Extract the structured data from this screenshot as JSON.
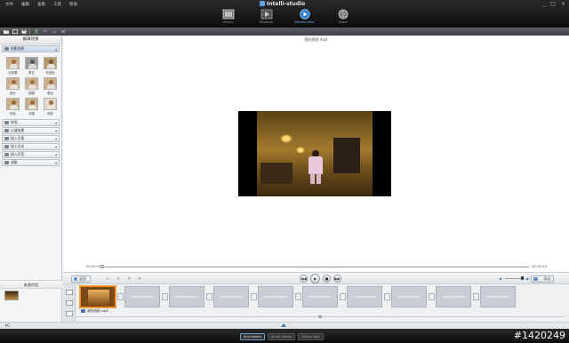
{
  "menu": [
    "文件",
    "编辑",
    "查看",
    "工具",
    "帮助"
  ],
  "brand": "Intelli-studio",
  "window_controls": [
    "_",
    "□",
    "×"
  ],
  "modes": [
    {
      "label": "Library",
      "icon": "library-icon",
      "active": false
    },
    {
      "label": "Playback",
      "icon": "film-icon",
      "active": false
    },
    {
      "label": "Moviemaker",
      "icon": "movie-edit-icon",
      "active": true
    },
    {
      "label": "Share",
      "icon": "globe-icon",
      "active": false
    }
  ],
  "left_panel": {
    "title": "编辑效果",
    "effects_section": "电影效果",
    "effects": [
      {
        "label": "无效果",
        "style": "normal"
      },
      {
        "label": "黑白",
        "style": "bw"
      },
      {
        "label": "怀旧色",
        "style": "sepia"
      },
      {
        "label": "胶片",
        "style": "normal"
      },
      {
        "label": "模糊",
        "style": "blur"
      },
      {
        "label": "暗淡",
        "style": "normal"
      },
      {
        "label": "锐化",
        "style": "normal"
      },
      {
        "label": "浮雕",
        "style": "normal"
      },
      {
        "label": "明亮",
        "style": "pale"
      }
    ],
    "sections": [
      "转场",
      "过渡效果",
      "插入字幕",
      "插入文本",
      "插入声音",
      "调整"
    ],
    "source_title": "来源片段"
  },
  "viewer": {
    "title": "我的视频.mp4",
    "time_start": "00:00:00",
    "time_end": "00:00:15",
    "progress": 0
  },
  "controls": {
    "back_label": "返回",
    "edit_tools": [
      "✂",
      "A",
      "A",
      "⟲"
    ],
    "transport": [
      "◀◀",
      "▶",
      "■",
      "▶▶"
    ],
    "volume_min_icon": "◀",
    "volume_max_icon": "◀)",
    "volume": 0.85,
    "export_label": "导出"
  },
  "timeline": {
    "clip_placeholder": "Intelli-studio",
    "placeholder_count": 9,
    "clip_label": "我的视频.mp4"
  },
  "status": {
    "pc_label": "PC"
  },
  "view_tabs": [
    {
      "label": "Storyboard",
      "active": true
    },
    {
      "label": "Smart Album",
      "active": false
    },
    {
      "label": "Global Map",
      "active": false
    }
  ],
  "watermark": "#1420249"
}
